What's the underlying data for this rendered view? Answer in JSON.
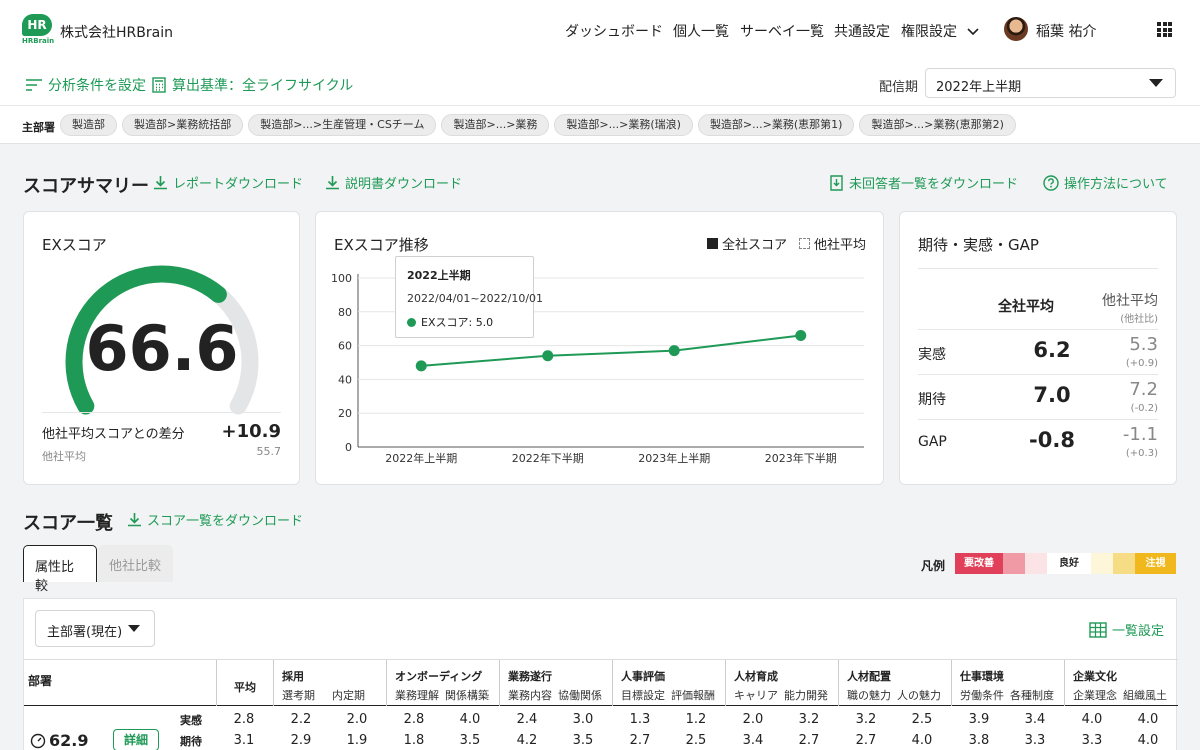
{
  "header": {
    "logo_badge": "HR",
    "logo_text": "HRBrain",
    "company": "株式会社HRBrain",
    "nav": [
      "ダッシュボード",
      "個人一覧",
      "サーベイ一覧",
      "共通設定",
      "権限設定"
    ],
    "user_name": "稲葉 祐介"
  },
  "filters": {
    "analysis_conditions": "分析条件を設定",
    "calc_basis": "算出基準：全ライフサイクル",
    "period_label": "配信期",
    "period_value": "2022年上半期"
  },
  "dept_chips": {
    "label": "主部署",
    "items": [
      "製造部",
      "製造部>業務統括部",
      "製造部>...>生産管理・CSチーム",
      "製造部>...>業務",
      "製造部>...>業務(瑞浪)",
      "製造部>...>業務(恵那第1)",
      "製造部>...>業務(恵那第2)"
    ]
  },
  "summary": {
    "title": "スコアサマリー",
    "report_download": "レポートダウンロード",
    "manual_download": "説明書ダウンロード",
    "unanswered_download": "未回答者一覧をダウンロード",
    "how_to": "操作方法について"
  },
  "ex_score": {
    "title": "EXスコア",
    "value": "66.6",
    "gauge_fraction": 0.666,
    "diff_label": "他社平均スコアとの差分",
    "diff_value": "+10.9",
    "other_label": "他社平均",
    "other_value": "55.7"
  },
  "trend": {
    "title": "EXスコア推移",
    "legend_company": "全社スコア",
    "legend_other": "他社平均",
    "tooltip_title": "2022上半期",
    "tooltip_range": "2022/04/01~2022/10/01",
    "tooltip_value": "EXスコア: 5.0"
  },
  "chart_data": {
    "type": "line",
    "categories": [
      "2022年上半期",
      "2022年下半期",
      "2023年上半期",
      "2023年下半期"
    ],
    "series": [
      {
        "name": "全社スコア",
        "values": [
          48,
          54,
          57,
          66
        ]
      }
    ],
    "ylim": [
      0,
      100
    ],
    "yticks": [
      "100",
      "80",
      "60",
      "40",
      "20",
      "0"
    ],
    "grid": true,
    "legend": "top-right"
  },
  "gap": {
    "title": "期待・実感・GAP",
    "col_company": "全社平均",
    "col_other": "他社平均",
    "col_other_sub": "(他社比)",
    "rows": [
      {
        "label": "実感",
        "company": "6.2",
        "other": "5.3",
        "diff": "(+0.9)"
      },
      {
        "label": "期待",
        "company": "7.0",
        "other": "7.2",
        "diff": "(-0.2)"
      },
      {
        "label": "GAP",
        "company": "-0.8",
        "other": "-1.1",
        "diff": "(+0.3)"
      }
    ]
  },
  "score_list": {
    "title": "スコア一覧",
    "download": "スコア一覧をダウンロード",
    "tab_attr": "属性比較",
    "tab_other": "他社比較",
    "legend_label": "凡例",
    "legend_bad": "要改善",
    "legend_good": "良好",
    "legend_caution": "注視",
    "dept_select": "主部署(現在)",
    "list_settings": "一覧設定",
    "col_dept": "部署",
    "col_avg": "平均",
    "groups": [
      {
        "name": "採用",
        "s1": "選考期",
        "s2": "内定期"
      },
      {
        "name": "オンボーディング",
        "s1": "業務理解",
        "s2": "関係構築"
      },
      {
        "name": "業務遂行",
        "s1": "業務内容",
        "s2": "協働関係"
      },
      {
        "name": "人事評価",
        "s1": "目標設定",
        "s2": "評価報酬"
      },
      {
        "name": "人材育成",
        "s1": "キャリア",
        "s2": "能力開発"
      },
      {
        "name": "人材配置",
        "s1": "職の魅力",
        "s2": "人の魅力"
      },
      {
        "name": "仕事環境",
        "s1": "労働条件",
        "s2": "各種制度"
      },
      {
        "name": "企業文化",
        "s1": "企業理念",
        "s2": "組織風土"
      }
    ],
    "row": {
      "score": "62.9",
      "detail": "詳細",
      "label_actual": "実感",
      "label_expect": "期待",
      "actual": [
        "2.8",
        "2.2",
        "2.0",
        "2.8",
        "4.0",
        "2.4",
        "3.0",
        "1.3",
        "1.2",
        "2.0",
        "3.2",
        "3.2",
        "2.5",
        "3.9",
        "3.4",
        "4.0",
        "4.0"
      ],
      "expect": [
        "3.1",
        "2.9",
        "1.9",
        "1.8",
        "3.5",
        "4.2",
        "3.5",
        "2.7",
        "2.5",
        "3.4",
        "2.7",
        "2.7",
        "4.0",
        "3.8",
        "3.3",
        "3.3",
        "4.0"
      ]
    }
  }
}
